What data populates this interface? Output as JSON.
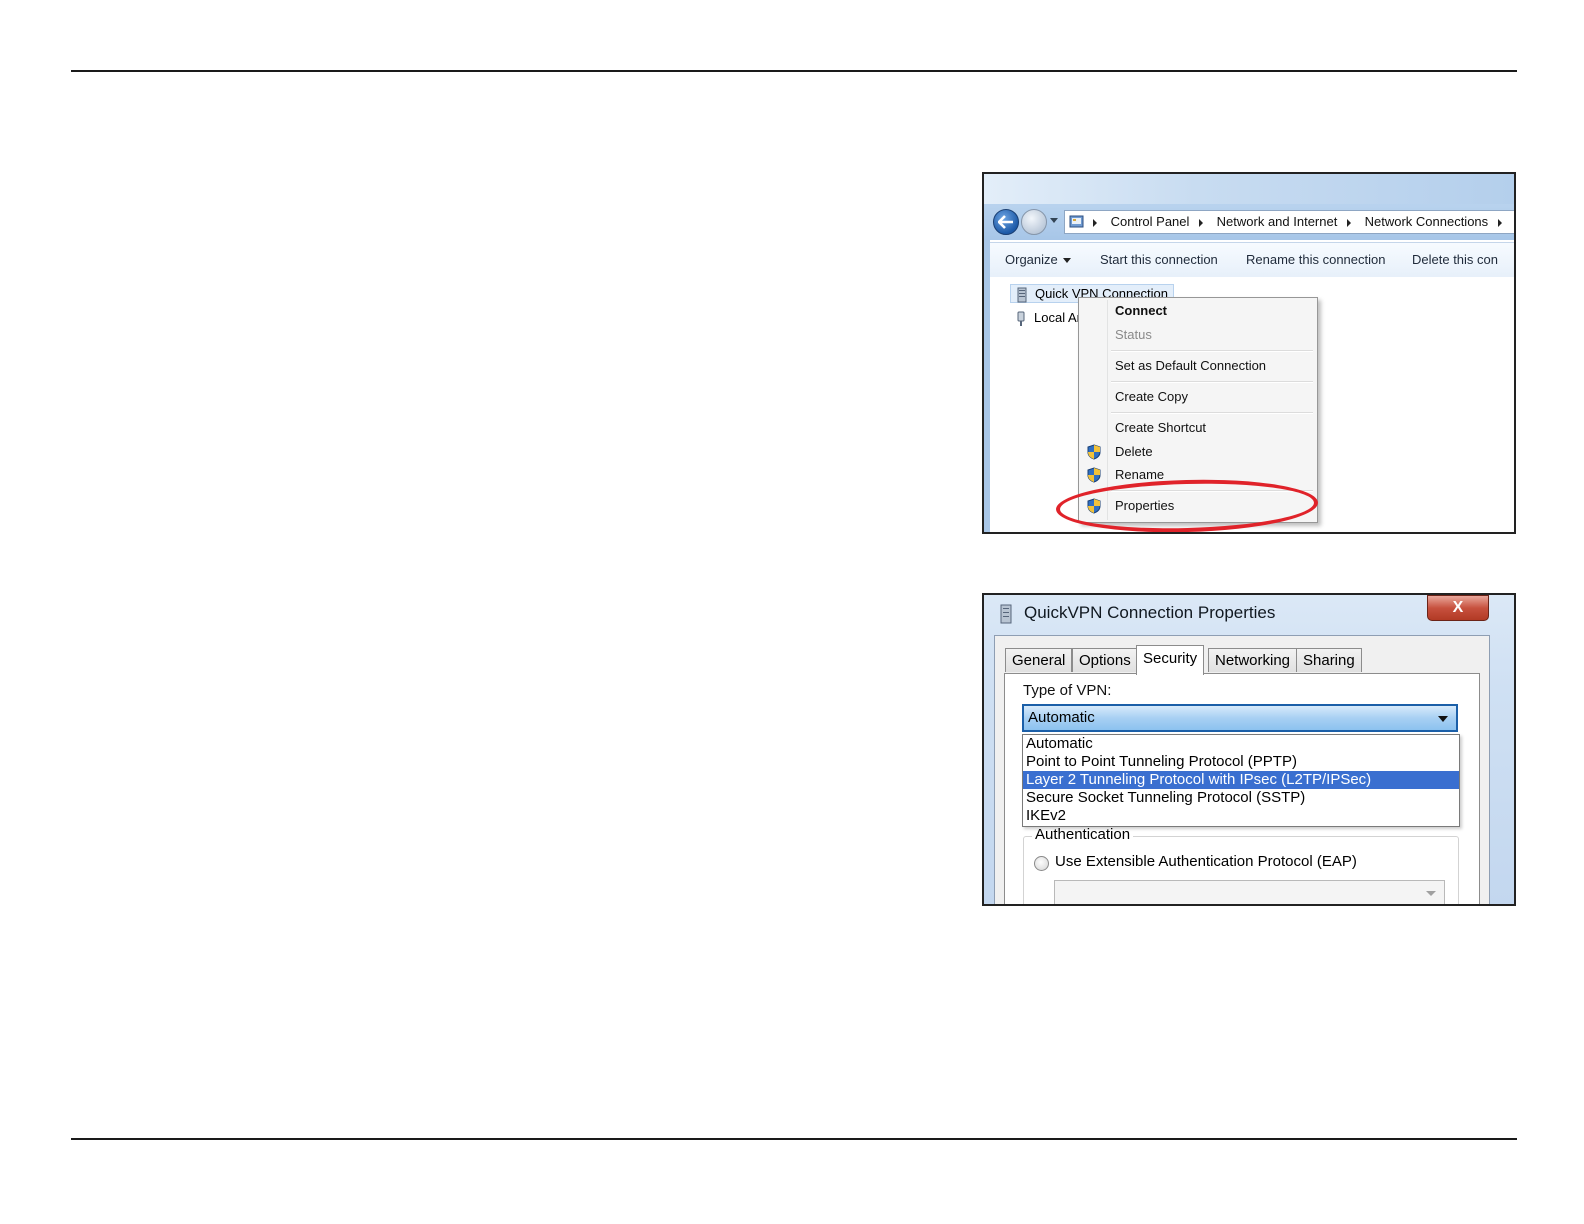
{
  "explorer": {
    "breadcrumb": [
      "Control Panel",
      "Network and Internet",
      "Network Connections"
    ],
    "toolbar": {
      "organize": "Organize",
      "start": "Start this connection",
      "rename": "Rename this connection",
      "delete": "Delete this con"
    },
    "connections": [
      "Quick VPN Connection",
      "Local Are"
    ],
    "context_menu": {
      "connect": "Connect",
      "status": "Status",
      "set_default": "Set as Default Connection",
      "create_copy": "Create Copy",
      "create_shortcut": "Create Shortcut",
      "delete": "Delete",
      "rename": "Rename",
      "properties": "Properties"
    },
    "highlight_color": "#e0232a"
  },
  "dialog": {
    "title": "QuickVPN Connection Properties",
    "close_label": "X",
    "tabs": [
      "General",
      "Options",
      "Security",
      "Networking",
      "Sharing"
    ],
    "active_tab": "Security",
    "vpn_type_label": "Type of VPN:",
    "vpn_type_value": "Automatic",
    "vpn_options": [
      "Automatic",
      "Point to Point Tunneling Protocol (PPTP)",
      "Layer 2 Tunneling Protocol with IPsec (L2TP/IPSec)",
      "Secure Socket Tunneling Protocol (SSTP)",
      "IKEv2"
    ],
    "highlighted_option": "Layer 2 Tunneling Protocol with IPsec (L2TP/IPSec)",
    "authentication_title": "Authentication",
    "eap_label": "Use Extensible Authentication Protocol (EAP)"
  }
}
